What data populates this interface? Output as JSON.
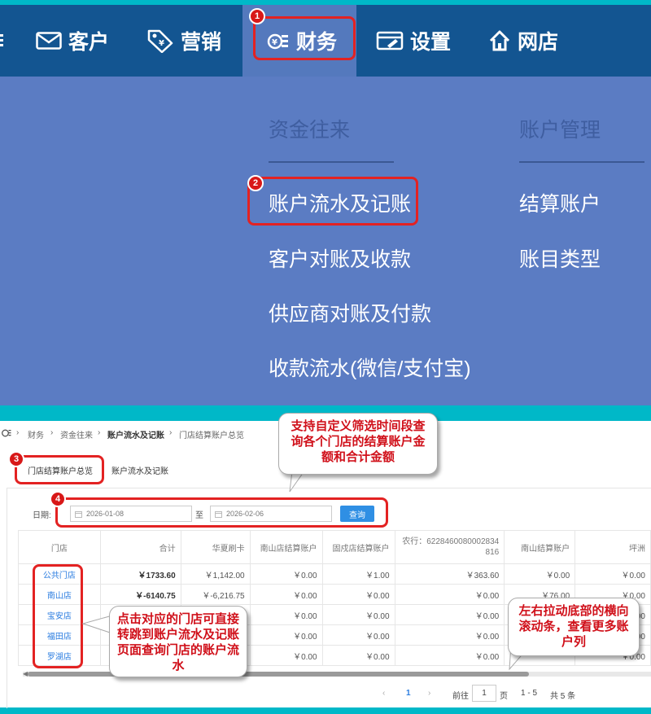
{
  "nav": {
    "items": [
      {
        "label": "客户",
        "icon": "mail-icon"
      },
      {
        "label": "营销",
        "icon": "tag-icon"
      },
      {
        "label": "财务",
        "icon": "finance-icon"
      },
      {
        "label": "设置",
        "icon": "settings-icon"
      },
      {
        "label": "网店",
        "icon": "home-icon"
      }
    ]
  },
  "dropdown": {
    "col1_heading": "资金往来",
    "col2_heading": "账户管理",
    "col1_items": [
      "账户流水及记账",
      "客户对账及收款",
      "供应商对账及付款",
      "收款流水(微信/支付宝)"
    ],
    "col2_items": [
      "结算账户",
      "账目类型"
    ]
  },
  "breadcrumb": [
    "财务",
    "资金往来",
    "账户流水及记账",
    "门店结算账户总览"
  ],
  "tabs": [
    "门店结算账户总览",
    "账户流水及记账"
  ],
  "filter": {
    "label": "日期:",
    "start": "2026-01-08",
    "sep": "至",
    "end": "2026-02-06",
    "query": "查询"
  },
  "table": {
    "headers": [
      "门店",
      "合计",
      "华夏刷卡",
      "南山店结算账户",
      "固戍店结算账户",
      "农行：6228460080002834816",
      "南山结算账户",
      "坪洲"
    ],
    "rows": [
      [
        "公共门店",
        "￥1733.60",
        "￥1,142.00",
        "￥0.00",
        "￥1.00",
        "￥363.60",
        "￥0.00",
        "￥0.00"
      ],
      [
        "南山店",
        "￥-6140.75",
        "￥-6,216.75",
        "￥0.00",
        "￥0.00",
        "￥0.00",
        "￥76.00",
        "￥0.00"
      ],
      [
        "宝安店",
        "",
        "",
        "￥0.00",
        "￥0.00",
        "￥0.00",
        "",
        "￥0.00"
      ],
      [
        "福田店",
        "",
        "",
        "￥0.00",
        "￥0.00",
        "￥0.00",
        "",
        "￥0.00"
      ],
      [
        "罗湖店",
        "",
        "",
        "￥0.00",
        "￥0.00",
        "￥0.00",
        "",
        "￥0.00"
      ]
    ]
  },
  "pager": {
    "prev": "‹",
    "current": "1",
    "next": "›",
    "goto": "前往",
    "page_input": "1",
    "page_unit": "页",
    "range": "1 - 5",
    "total": "共 5 条"
  },
  "markers": [
    "1",
    "2",
    "3",
    "4"
  ],
  "callouts": {
    "date_filter": "支持自定义筛选时间段查询各个门店的结算账户金额和合计金额",
    "store_link": "点击对应的门店可直接转跳到账户流水及记账页面查询门店的账户流水",
    "scroll": "左右拉动底部的横向滚动条，查看更多账户列"
  },
  "colors": {
    "nav_bg": "#135591",
    "dropdown_bg": "#5b7cc3",
    "accent_red": "#e32222",
    "border_teal": "#00b8c8",
    "link_blue": "#2b7de0",
    "button_blue": "#2f8fe4"
  }
}
